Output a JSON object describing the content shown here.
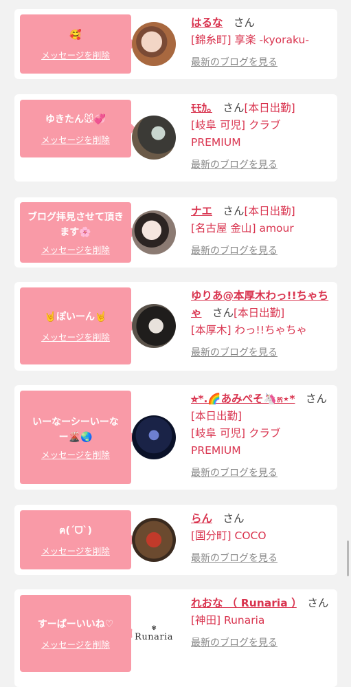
{
  "delete_label": "メッセージを削除",
  "blog_label": "最新のブログを見る",
  "cards": [
    {
      "message": "🥰",
      "name": "はるな",
      "honorific": "さん",
      "status": "",
      "location": "[錦糸町] 享楽 -kyoraku-"
    },
    {
      "message": "ゆきたん🐭💞",
      "name": "ﾓﾓｶ｡",
      "honorific": "さん",
      "status": "[本日出勤]",
      "location": "[岐阜 可児] クラブ PREMIUM"
    },
    {
      "message": "ブログ拝見させて頂きます🌸",
      "name": "ナエ",
      "honorific": "さん",
      "status": "[本日出勤]",
      "location": "[名古屋 金山] amour"
    },
    {
      "message": "🤘ぽいーん🤘",
      "name": "ゆりあ@本厚木わっ!!ちゃちゃ",
      "honorific": "さん",
      "status": "[本日出勤]",
      "location": "[本厚木] わっ!!ちゃちゃ"
    },
    {
      "message": "いーなーシーいーなー🌋🌏",
      "name": "⭐︎*.🌈あみぺそ🦄೫⋆*",
      "honorific": "さん",
      "status": "[本日出勤]",
      "location": "[岐阜 可児] クラブ PREMIUM"
    },
    {
      "message": "ฅ(ˊᗜˋ)",
      "name": "らん",
      "honorific": "さん",
      "status": "",
      "location": "[国分町] COCO"
    },
    {
      "message": "すーぱーいいね♡",
      "name": "れおな （ Runaria ）",
      "honorific": "さん",
      "status": "",
      "location": "[神田] Runaria",
      "logo_text": "Runaria"
    }
  ],
  "colors": {
    "bubble": "#f99aa7",
    "name": "#d9344f",
    "background": "#f2f2f2"
  }
}
